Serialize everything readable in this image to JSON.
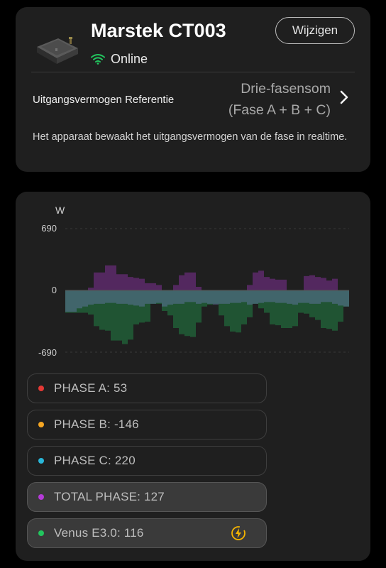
{
  "device": {
    "name": "Marstek CT003",
    "status": "Online",
    "edit_label": "Wijzigen",
    "reference_label": "Uitgangsvermogen Referentie",
    "reference_value_line1": "Drie-fasensom",
    "reference_value_line2": "(Fase A + B + C)",
    "description": "Het apparaat bewaakt het uitgangsvermogen van de fase in realtime."
  },
  "colors": {
    "online": "#22c55e",
    "phase_a": "#e53935",
    "phase_b": "#f5a623",
    "phase_c": "#29b6d8",
    "total": "#b53ad8",
    "venus": "#22c55e",
    "bolt": "#f5b400"
  },
  "chart_data": {
    "type": "area",
    "ylabel": "W",
    "ylim": [
      -690,
      690
    ],
    "y_ticks": [
      "690",
      "0",
      "-690"
    ],
    "x": [
      0,
      1,
      2,
      3,
      4,
      5,
      6,
      7,
      8,
      9,
      10,
      11,
      12,
      13,
      14,
      15,
      16,
      17,
      18,
      19,
      20,
      21,
      22,
      23,
      24,
      25,
      26,
      27,
      28,
      29,
      30,
      31,
      32,
      33,
      34,
      35,
      36,
      37,
      38,
      39,
      40,
      41,
      42,
      43,
      44,
      45,
      46,
      47,
      48,
      49,
      50
    ],
    "series": [
      {
        "name": "TOTAL PHASE",
        "values": [
          0,
          0,
          0,
          0,
          30,
          200,
          200,
          280,
          280,
          180,
          180,
          150,
          140,
          130,
          80,
          80,
          60,
          0,
          0,
          60,
          170,
          200,
          200,
          40,
          0,
          0,
          0,
          0,
          0,
          0,
          0,
          0,
          60,
          200,
          220,
          150,
          130,
          120,
          120,
          0,
          0,
          0,
          160,
          170,
          150,
          140,
          110,
          130,
          0,
          0,
          120
        ]
      },
      {
        "name": "Venus E3.0",
        "values": [
          -250,
          -250,
          -250,
          -250,
          -270,
          -400,
          -440,
          -450,
          -560,
          -560,
          -600,
          -550,
          -380,
          -360,
          -350,
          -150,
          -150,
          -230,
          -280,
          -420,
          -490,
          -510,
          -520,
          -360,
          -180,
          -160,
          -150,
          -280,
          -400,
          -460,
          -470,
          -380,
          -300,
          -150,
          -200,
          -250,
          -380,
          -390,
          -420,
          -420,
          -400,
          -250,
          -260,
          -300,
          -330,
          -420,
          -430,
          -450,
          -350,
          -180,
          -160
        ]
      },
      {
        "name": "PHASE C",
        "values": [
          -240,
          -240,
          -200,
          -180,
          -160,
          -150,
          -150,
          -140,
          -140,
          -150,
          -150,
          -160,
          -170,
          -180,
          -150,
          -150,
          -140,
          -180,
          -160,
          -150,
          -150,
          -130,
          -130,
          -150,
          -140,
          -150,
          -160,
          -150,
          -150,
          -140,
          -140,
          -130,
          -160,
          -150,
          -140,
          -130,
          -130,
          -140,
          -140,
          -150,
          -160,
          -140,
          -140,
          -150,
          -150,
          -130,
          -130,
          -150,
          -170,
          -180,
          -180
        ]
      }
    ],
    "legend": [
      {
        "label": "PHASE A: 53",
        "color_key": "phase_a",
        "active": false
      },
      {
        "label": "PHASE B: -146",
        "color_key": "phase_b",
        "active": false
      },
      {
        "label": "PHASE C: 220",
        "color_key": "phase_c",
        "active": false
      },
      {
        "label": "TOTAL PHASE: 127",
        "color_key": "total",
        "active": true
      },
      {
        "label": "Venus E3.0: 116",
        "color_key": "venus",
        "active": true,
        "icon": "lightning-bolt-icon"
      }
    ]
  }
}
